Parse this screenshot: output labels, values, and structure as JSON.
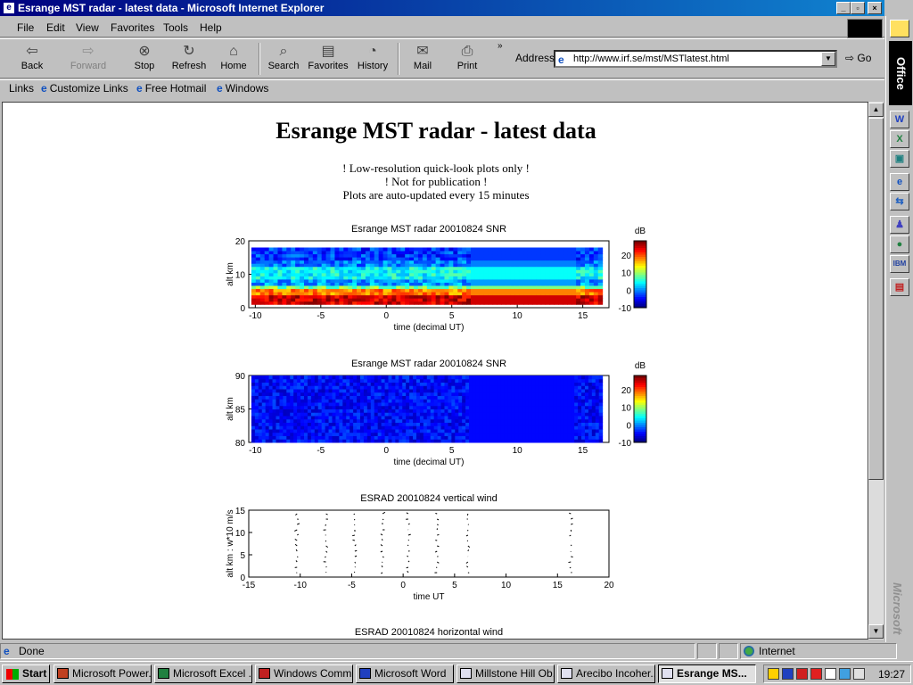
{
  "window": {
    "title": "Esrange MST radar - latest data - Microsoft Internet Explorer"
  },
  "menubar": {
    "items": [
      "File",
      "Edit",
      "View",
      "Favorites",
      "Tools",
      "Help"
    ]
  },
  "toolbar": {
    "back": "Back",
    "forward": "Forward",
    "stop": "Stop",
    "refresh": "Refresh",
    "home": "Home",
    "search": "Search",
    "favorites": "Favorites",
    "history": "History",
    "mail": "Mail",
    "print": "Print",
    "address_label": "Address",
    "address_value": "http://www.irf.se/mst/MSTlatest.html",
    "go": "Go"
  },
  "links_bar": {
    "label": "Links",
    "items": [
      "Customize Links",
      "Free Hotmail",
      "Windows"
    ]
  },
  "page": {
    "title": "Esrange MST radar - latest data",
    "notice_1": "! Low-resolution quick-look plots only !",
    "notice_2": "! Not for publication !",
    "notice_3": "Plots are auto-updated every 15 minutes",
    "plot4_title": "ESRAD 20010824 horizontal wind"
  },
  "chart_data": [
    {
      "type": "heatmap",
      "title": "Esrange MST radar 20010824  SNR",
      "xlabel": "time (decimal UT)",
      "ylabel": "alt km",
      "xlim": [
        -10.5,
        17
      ],
      "ylim": [
        0,
        20
      ],
      "xticks": [
        "-10",
        "-5",
        "0",
        "5",
        "10",
        "15"
      ],
      "yticks": [
        "0",
        "10",
        "20"
      ],
      "colorbar_label": "dB",
      "colorbar_ticks": [
        "-10",
        "0",
        "10",
        "20"
      ],
      "colorbar_range": [
        -10,
        28
      ]
    },
    {
      "type": "heatmap",
      "title": "Esrange MST radar 20010824  SNR",
      "xlabel": "time (decimal UT)",
      "ylabel": "alt km",
      "xlim": [
        -10.5,
        17
      ],
      "ylim": [
        80,
        90
      ],
      "xticks": [
        "-10",
        "-5",
        "0",
        "5",
        "10",
        "15"
      ],
      "yticks": [
        "80",
        "85",
        "90"
      ],
      "colorbar_label": "dB",
      "colorbar_ticks": [
        "-10",
        "0",
        "10",
        "20"
      ],
      "colorbar_range": [
        -10,
        28
      ]
    },
    {
      "type": "scatter",
      "title": "ESRAD 20010824 vertical wind",
      "xlabel": "time  UT",
      "ylabel": "alt km : w*10  m/s",
      "xlim": [
        -15,
        20
      ],
      "ylim": [
        0,
        15
      ],
      "xticks": [
        "-15",
        "-10",
        "-5",
        "0",
        "5",
        "10",
        "15",
        "20"
      ],
      "yticks": [
        "0",
        "5",
        "10",
        "15"
      ],
      "profile_times": [
        -10.3,
        -7.5,
        -4.7,
        -2.0,
        0.5,
        3.3,
        6.3,
        16.3
      ]
    }
  ],
  "status": {
    "left": "Done",
    "zone": "Internet"
  },
  "taskbar": {
    "start": "Start",
    "tasks": [
      "Microsoft Power...",
      "Microsoft Excel ...",
      "Windows Comm...",
      "Microsoft Word",
      "Millstone Hill Ob...",
      "Arecibo Incoher...",
      "Esrange MS..."
    ],
    "clock": "19:27"
  },
  "officebar": {
    "label": "Office",
    "vendor": "Microsoft"
  }
}
